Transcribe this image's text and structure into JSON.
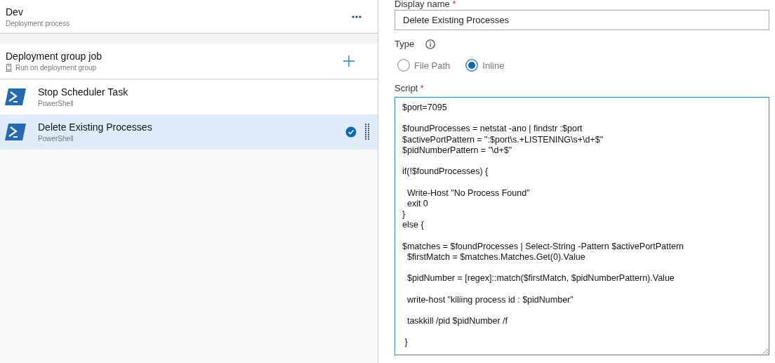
{
  "stage": {
    "title": "Dev",
    "subtitle": "Deployment process"
  },
  "job": {
    "title": "Deployment group job",
    "subtitle": "Run on deployment group"
  },
  "tasks": [
    {
      "name": "Stop Scheduler Task",
      "type": "PowerShell",
      "selected": false
    },
    {
      "name": "Delete Existing Processes",
      "type": "PowerShell",
      "selected": true
    }
  ],
  "display_name": {
    "label": "Display name",
    "required_mark": "*",
    "value": "Delete Existing Processes"
  },
  "type": {
    "label": "Type",
    "options": [
      {
        "label": "File Path",
        "selected": false
      },
      {
        "label": "Inline",
        "selected": true
      }
    ]
  },
  "script": {
    "label": "Script",
    "required_mark": "*",
    "blocks": [
      [
        "$port=7095"
      ],
      [
        "$foundProcesses = netstat -ano | findstr :$port",
        "$activePortPattern = \":$port\\s.+LISTENING\\s+\\d+$\"",
        "$pidNumberPattern = \"\\d+$\""
      ],
      [
        "if(!$foundProcesses) {"
      ],
      [
        "  Write-Host \"No Process Found\"",
        "  exit 0",
        "}",
        "else {"
      ],
      [
        "$matches = $foundProcesses | Select-String -Pattern $activePortPattern",
        "  $firstMatch = $matches.Matches.Get(0).Value"
      ],
      [
        "  $pidNumber = [regex]::match($firstMatch, $pidNumberPattern).Value"
      ],
      [
        "  write-host \"kiliing process id : $pidNumber\""
      ],
      [
        "  taskkill /pid $pidNumber /f"
      ],
      [
        " }"
      ]
    ]
  }
}
